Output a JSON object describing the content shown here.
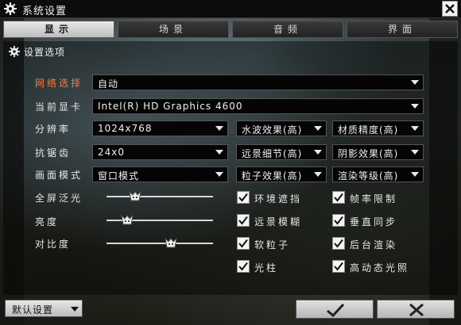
{
  "window": {
    "title": "系统设置",
    "close_icon": "close-icon"
  },
  "tabs": [
    {
      "label": "显示",
      "active": true
    },
    {
      "label": "场景",
      "active": false
    },
    {
      "label": "音频",
      "active": false
    },
    {
      "label": "界面",
      "active": false
    }
  ],
  "section": {
    "title": "设置选项"
  },
  "rows": {
    "network": {
      "label": "网络选择",
      "value": "自动"
    },
    "gpu": {
      "label": "当前显卡",
      "value": "Intel(R) HD Graphics 4600"
    },
    "resolution": {
      "label": "分辨率",
      "value": "1024x768",
      "water": "水波效果(高)",
      "material": "材质精度(高)"
    },
    "antialias": {
      "label": "抗锯齿",
      "value": "24x0",
      "distant": "远景细节(高)",
      "shadow": "阴影效果(高)"
    },
    "mode": {
      "label": "画面模式",
      "value": "窗口模式",
      "particle": "粒子效果(高)",
      "render": "渲染等级(高)"
    }
  },
  "sliders": [
    {
      "label": "全屏泛光",
      "level": 0.24
    },
    {
      "label": "亮度",
      "level": 0.15
    },
    {
      "label": "对比度",
      "level": 0.62
    }
  ],
  "checkboxes": [
    {
      "label": "环境遮挡",
      "checked": true
    },
    {
      "label": "帧率限制",
      "checked": true
    },
    {
      "label": "远景模糊",
      "checked": true
    },
    {
      "label": "垂直同步",
      "checked": true
    },
    {
      "label": "软粒子",
      "checked": true
    },
    {
      "label": "后台渲染",
      "checked": true
    },
    {
      "label": "光柱",
      "checked": true
    },
    {
      "label": "高动态光照",
      "checked": true
    }
  ],
  "footer": {
    "default_label": "默认设置"
  },
  "colors": {
    "highlight_label": "#ff7a30",
    "active_tab": "#d8d8d8"
  }
}
